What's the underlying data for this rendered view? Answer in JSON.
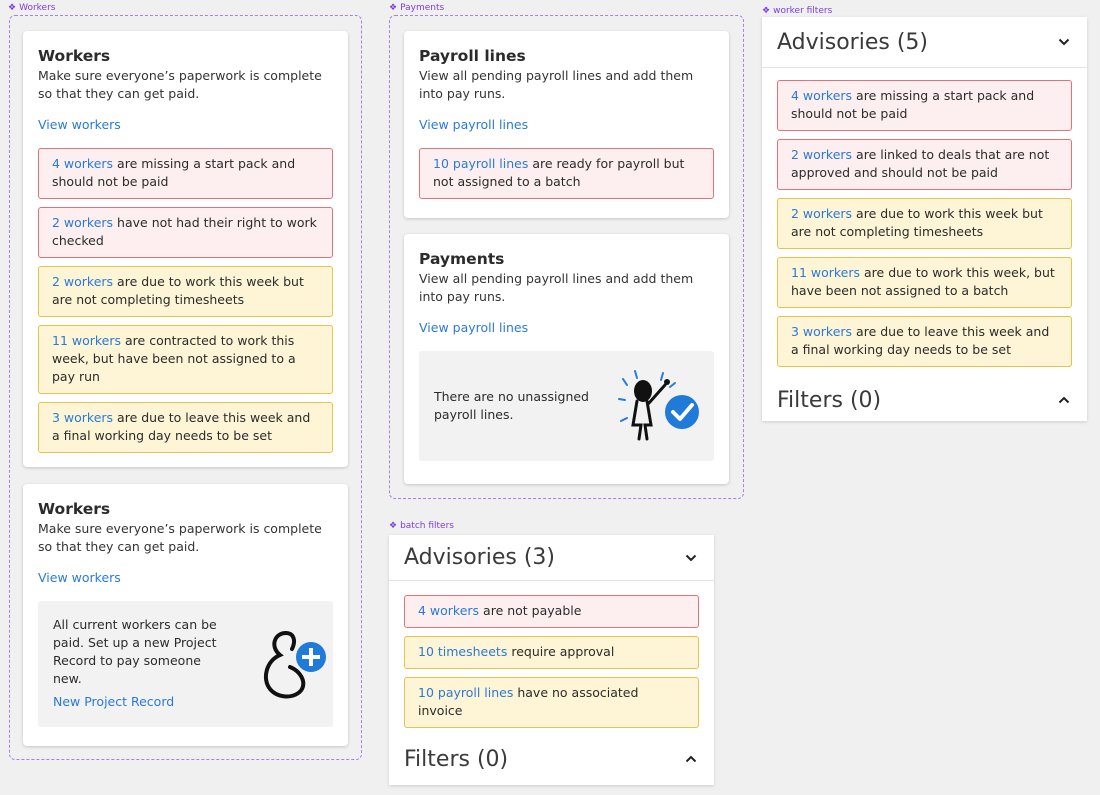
{
  "frames": {
    "workers": "Workers",
    "payments": "Payments",
    "worker_filters": "worker filters",
    "batch_filters": "batch filters"
  },
  "workers_card": {
    "title": "Workers",
    "description": "Make sure everyone’s paperwork is complete so that they can get paid.",
    "view_link": "View workers",
    "alerts": [
      {
        "link": "4 workers",
        "text": " are missing a start pack and should not be paid",
        "level": "red"
      },
      {
        "link": "2 workers",
        "text": " have not had their right to work checked",
        "level": "red"
      },
      {
        "link": "2 workers",
        "text": " are due to work this week but are not completing timesheets",
        "level": "yellow"
      },
      {
        "link": "11 workers",
        "text": " are contracted to work this week, but have been not assigned to a pay run",
        "level": "yellow"
      },
      {
        "link": "3 workers",
        "text": " are due to leave this week and a final working day needs to be set",
        "level": "yellow"
      }
    ]
  },
  "workers_empty_card": {
    "title": "Workers",
    "description": "Make sure everyone’s paperwork is complete so that they can get paid.",
    "view_link": "View workers",
    "empty_text": "All current workers can be paid. Set up a new Project Record to pay someone new.",
    "empty_link": "New Project Record"
  },
  "payroll_card": {
    "title": "Payroll lines",
    "description": "View all pending payroll lines and add them into pay runs.",
    "view_link": "View payroll lines",
    "alerts": [
      {
        "link": "10 payroll lines",
        "text": " are ready for payroll but not assigned to a batch",
        "level": "red"
      }
    ]
  },
  "payments_card": {
    "title": "Payments",
    "description": "View all pending payroll lines and add them into pay runs.",
    "view_link": "View payroll lines",
    "empty_text": "There are no unassigned payroll lines."
  },
  "worker_filters": {
    "advisories_title": "Advisories (5)",
    "filters_title": "Filters (0)",
    "alerts": [
      {
        "link": "4 workers",
        "text": " are missing a start pack and should not be paid",
        "level": "red"
      },
      {
        "link": "2 workers",
        "text": " are linked to deals that are not approved and should not be paid",
        "level": "red"
      },
      {
        "link": "2 workers",
        "text": " are due to work this week but are not completing timesheets",
        "level": "yellow"
      },
      {
        "link": "11 workers",
        "text": " are due to work this week, but have been not assigned to a batch",
        "level": "yellow"
      },
      {
        "link": "3 workers",
        "text": " are due to leave this week and a final working day needs to be set",
        "level": "yellow"
      }
    ]
  },
  "batch_filters": {
    "advisories_title": "Advisories (3)",
    "filters_title": "Filters (0)",
    "alerts": [
      {
        "link": "4 workers",
        "text": " are not payable",
        "level": "red"
      },
      {
        "link": "10 timesheets",
        "text": " require approval",
        "level": "yellow"
      },
      {
        "link": "10 payroll lines",
        "text": " have no associated invoice",
        "level": "yellow"
      }
    ]
  },
  "colors": {
    "link": "#2a7ad8",
    "red_border": "#e0727b",
    "red_bg": "#fdeff0",
    "yellow_border": "#e7c24c",
    "yellow_bg": "#fdf5d6",
    "frame": "#a57ef0"
  }
}
